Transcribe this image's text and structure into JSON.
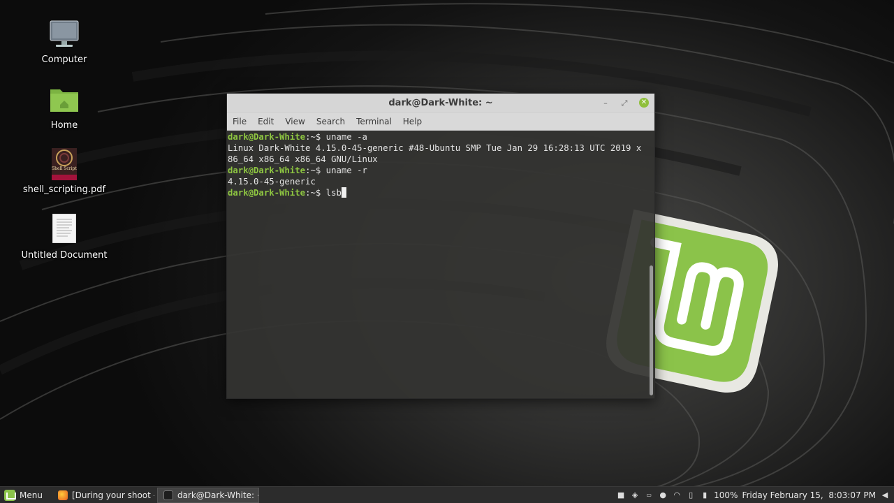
{
  "desktop": {
    "icons": [
      {
        "label": "Computer",
        "icon": "computer-icon"
      },
      {
        "label": "Home",
        "icon": "home-folder-icon"
      },
      {
        "label": "shell_scripting.pdf",
        "icon": "pdf-file-icon"
      },
      {
        "label": "Untitled Document",
        "icon": "text-document-icon"
      }
    ],
    "pdf_cover_text": "Shell Scripting"
  },
  "terminal": {
    "title": "dark@Dark-White: ~",
    "window_buttons": {
      "minimize": "–",
      "maximize": "⤢",
      "close": "✕"
    },
    "menu": [
      "File",
      "Edit",
      "View",
      "Search",
      "Terminal",
      "Help"
    ],
    "prompt_user": "dark@Dark-White",
    "prompt_sep": ":~$",
    "lines": [
      {
        "type": "cmd",
        "text": " uname -a"
      },
      {
        "type": "out",
        "text": "Linux Dark-White 4.15.0-45-generic #48-Ubuntu SMP Tue Jan 29 16:28:13 UTC 2019 x"
      },
      {
        "type": "out",
        "text": "86_64 x86_64 x86_64 GNU/Linux"
      },
      {
        "type": "cmd",
        "text": " uname -r"
      },
      {
        "type": "out",
        "text": "4.15.0-45-generic"
      },
      {
        "type": "cmd",
        "text": " lsb"
      }
    ]
  },
  "taskbar": {
    "menu_label": "Menu",
    "tasks": [
      {
        "label": "[During your shoot - Y...",
        "icon": "firefox-icon",
        "active": false
      },
      {
        "label": "dark@Dark-White: ~",
        "icon": "terminal-icon",
        "active": true
      }
    ],
    "tray": {
      "battery": "100%",
      "clock": "Friday February 15,  8:03:07 PM"
    }
  },
  "colors": {
    "prompt": "#8ec641",
    "mint_green": "#8bc34a",
    "taskbar": "#2c2c2c"
  }
}
